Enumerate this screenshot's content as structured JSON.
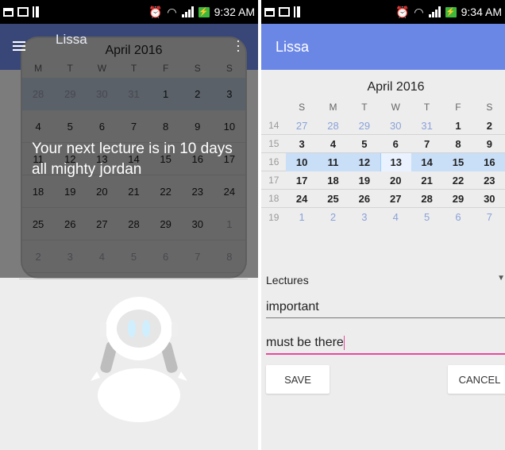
{
  "left": {
    "status_time": "9:32 AM",
    "app_title": "Lissa",
    "month": "April 2016",
    "weekdays": [
      "M",
      "T",
      "W",
      "T",
      "F",
      "S",
      "S"
    ],
    "weeks": [
      [
        "28",
        "29",
        "30",
        "31",
        "1",
        "2",
        "3"
      ],
      [
        "4",
        "5",
        "6",
        "7",
        "8",
        "9",
        "10"
      ],
      [
        "11",
        "12",
        "13",
        "14",
        "15",
        "16",
        "17"
      ],
      [
        "18",
        "19",
        "20",
        "21",
        "22",
        "23",
        "24"
      ],
      [
        "25",
        "26",
        "27",
        "28",
        "29",
        "30",
        "1"
      ],
      [
        "2",
        "3",
        "4",
        "5",
        "6",
        "7",
        "8"
      ]
    ],
    "toast": "Your next lecture is in 10 days all mighty jordan"
  },
  "right": {
    "status_time": "9:34 AM",
    "app_title": "Lissa",
    "month": "April 2016",
    "weekdays": [
      "S",
      "M",
      "T",
      "W",
      "T",
      "F",
      "S"
    ],
    "week_numbers": [
      "14",
      "15",
      "16",
      "17",
      "18",
      "19"
    ],
    "weeks": [
      [
        "27",
        "28",
        "29",
        "30",
        "31",
        "1",
        "2"
      ],
      [
        "3",
        "4",
        "5",
        "6",
        "7",
        "8",
        "9"
      ],
      [
        "10",
        "11",
        "12",
        "13",
        "14",
        "15",
        "16"
      ],
      [
        "17",
        "18",
        "19",
        "20",
        "21",
        "22",
        "23"
      ],
      [
        "24",
        "25",
        "26",
        "27",
        "28",
        "29",
        "30"
      ],
      [
        "1",
        "2",
        "3",
        "4",
        "5",
        "6",
        "7"
      ]
    ],
    "category": "Lectures",
    "field1": "important",
    "field2": "must be there",
    "save_label": "SAVE",
    "cancel_label": "CANCEL"
  },
  "colors": {
    "appbar": "#6b87e6",
    "accent": "#e8499b",
    "selected_week": "#c9def7"
  }
}
